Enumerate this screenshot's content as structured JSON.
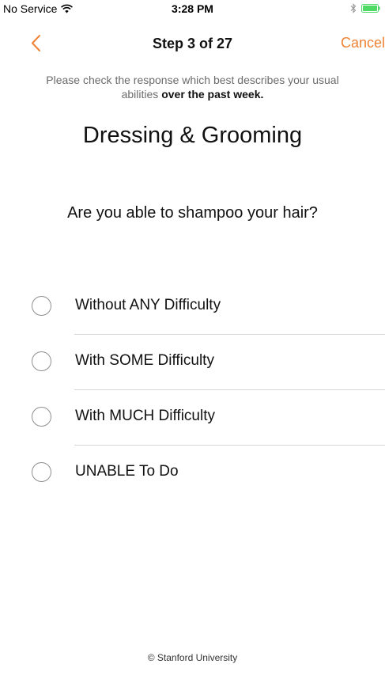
{
  "status_bar": {
    "carrier": "No Service",
    "time": "3:28 PM"
  },
  "nav": {
    "title": "Step 3 of 27",
    "cancel_label": "Cancel"
  },
  "instructions": {
    "text": "Please check the response which best describes your usual abilities ",
    "emphasis": "over the past week."
  },
  "section_title": "Dressing & Grooming",
  "question": "Are you able to shampoo your hair?",
  "options": [
    {
      "label": "Without ANY Difficulty",
      "selected": false
    },
    {
      "label": "With SOME Difficulty",
      "selected": false
    },
    {
      "label": "With MUCH Difficulty",
      "selected": false
    },
    {
      "label": "UNABLE To Do",
      "selected": false
    }
  ],
  "footer": "© Stanford University",
  "colors": {
    "accent": "#f08233",
    "battery": "#4cd964"
  }
}
